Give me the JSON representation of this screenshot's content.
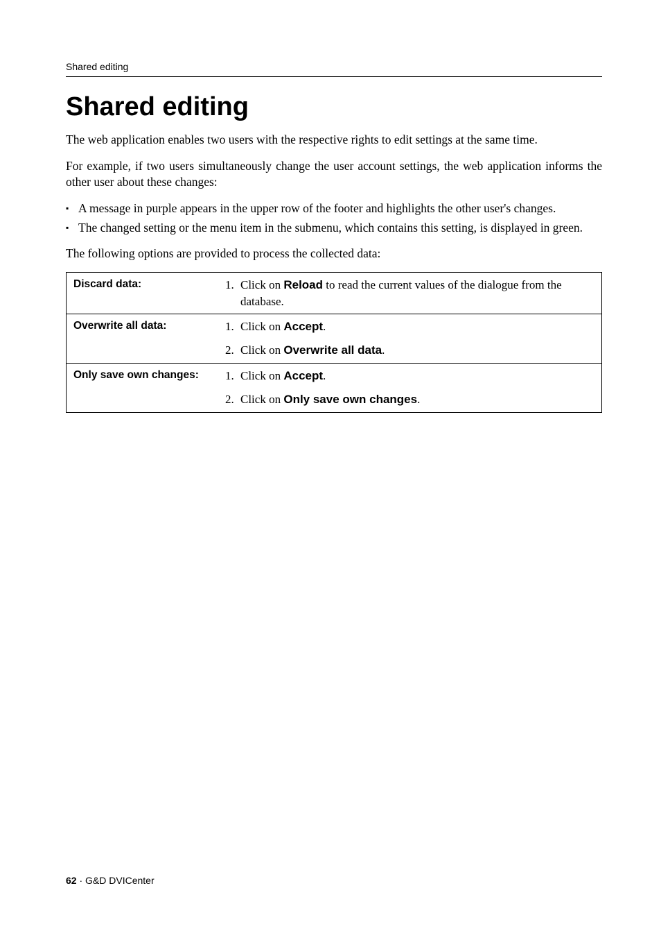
{
  "header": {
    "running": "Shared editing"
  },
  "title": "Shared editing",
  "paragraphs": {
    "intro1": "The web application enables two users with the respective rights to edit settings at the same time.",
    "intro2": "For example, if two users simultaneously change the user account settings, the web application informs the other user about these changes:",
    "after_list": "The following options are provided to process the collected data:"
  },
  "bullets": [
    "A message in purple appears in the upper row of the footer and highlights the other user's changes.",
    "The changed setting or the menu item in the submenu, which contains this setting, is displayed in green."
  ],
  "table": {
    "rows": [
      {
        "label": "Discard data:",
        "steps": [
          {
            "pre": "Click on ",
            "bold": "Reload",
            "post": " to read the current values of the dialogue from the database."
          }
        ]
      },
      {
        "label": "Overwrite all data:",
        "steps": [
          {
            "pre": "Click on ",
            "bold": "Accept",
            "post": "."
          },
          {
            "pre": "Click on ",
            "bold": "Overwrite all data",
            "post": "."
          }
        ]
      },
      {
        "label": "Only save own changes:",
        "steps": [
          {
            "pre": "Click on ",
            "bold": "Accept",
            "post": "."
          },
          {
            "pre": "Click on ",
            "bold": "Only save own changes",
            "post": "."
          }
        ]
      }
    ]
  },
  "footer": {
    "page": "62",
    "sep": " · ",
    "product": "G&D DVICenter"
  }
}
